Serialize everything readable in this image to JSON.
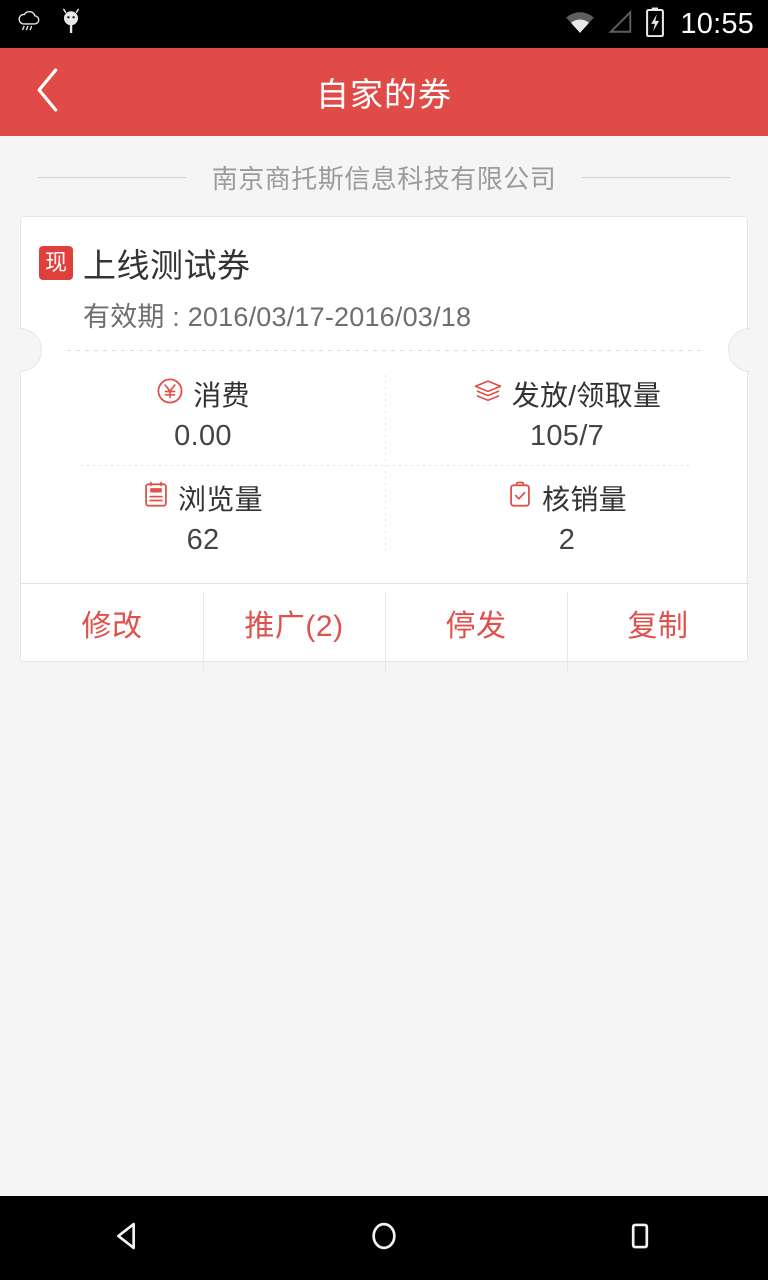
{
  "statusbar": {
    "time": "10:55",
    "icons": [
      "rain-cloud-icon",
      "android-head-icon",
      "wifi-icon",
      "cellular-signal-icon",
      "battery-charging-icon"
    ]
  },
  "appbar": {
    "title": "自家的券",
    "back_label": "back",
    "background": "#e04b47"
  },
  "company": {
    "name": "南京商托斯信息科技有限公司"
  },
  "coupon": {
    "badge": "现",
    "title": "上线测试券",
    "validity": "有效期 : 2016/03/17-2016/03/18",
    "accent": "#e0514c",
    "stats": [
      {
        "icon": "yen-circle-icon",
        "label": "消费",
        "value": "0.00"
      },
      {
        "icon": "layers-icon",
        "label": "发放/领取量",
        "value": "105/7"
      },
      {
        "icon": "browse-list-icon",
        "label": "浏览量",
        "value": "62"
      },
      {
        "icon": "clipboard-check-icon",
        "label": "核销量",
        "value": "2"
      }
    ],
    "actions": [
      {
        "label": "修改"
      },
      {
        "label": "推广(2)"
      },
      {
        "label": "停发"
      },
      {
        "label": "复制"
      }
    ]
  },
  "navbar": {
    "back": "back-triangle-icon",
    "home": "home-circle-icon",
    "recents": "recents-square-icon"
  }
}
